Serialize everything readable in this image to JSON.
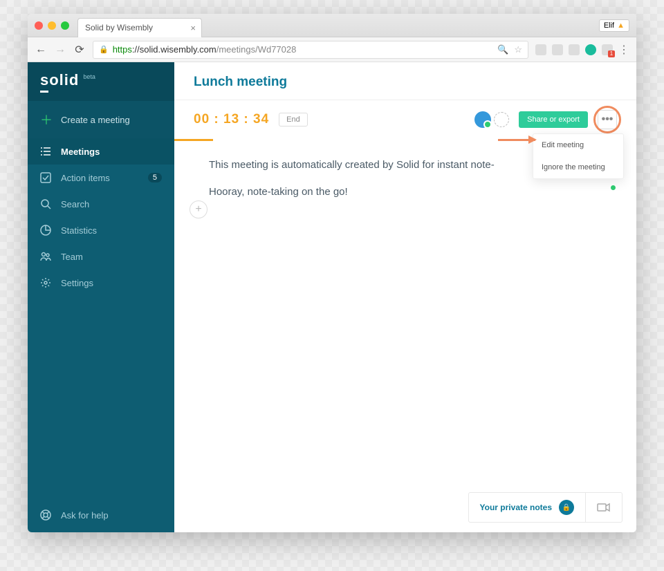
{
  "browser": {
    "tab_title": "Solid by Wisembly",
    "user_chip": "Elif",
    "url_https": "https",
    "url_host": "://solid.wisembly.com",
    "url_path": "/meetings/Wd77028"
  },
  "sidebar": {
    "logo": "solid",
    "beta": "beta",
    "create": "Create a meeting",
    "items": [
      {
        "label": "Meetings"
      },
      {
        "label": "Action items",
        "badge": "5"
      },
      {
        "label": "Search"
      },
      {
        "label": "Statistics"
      },
      {
        "label": "Team"
      },
      {
        "label": "Settings"
      }
    ],
    "help": "Ask for help"
  },
  "meeting": {
    "title": "Lunch meeting",
    "timer": "00 : 13 : 34",
    "end": "End",
    "share": "Share or export",
    "notes": [
      "This meeting is automatically created by Solid for instant note-",
      "Hooray, note-taking on the go!"
    ]
  },
  "dropdown": {
    "edit": "Edit meeting",
    "ignore": "Ignore the meeting"
  },
  "footer": {
    "private_notes": "Your private notes"
  }
}
